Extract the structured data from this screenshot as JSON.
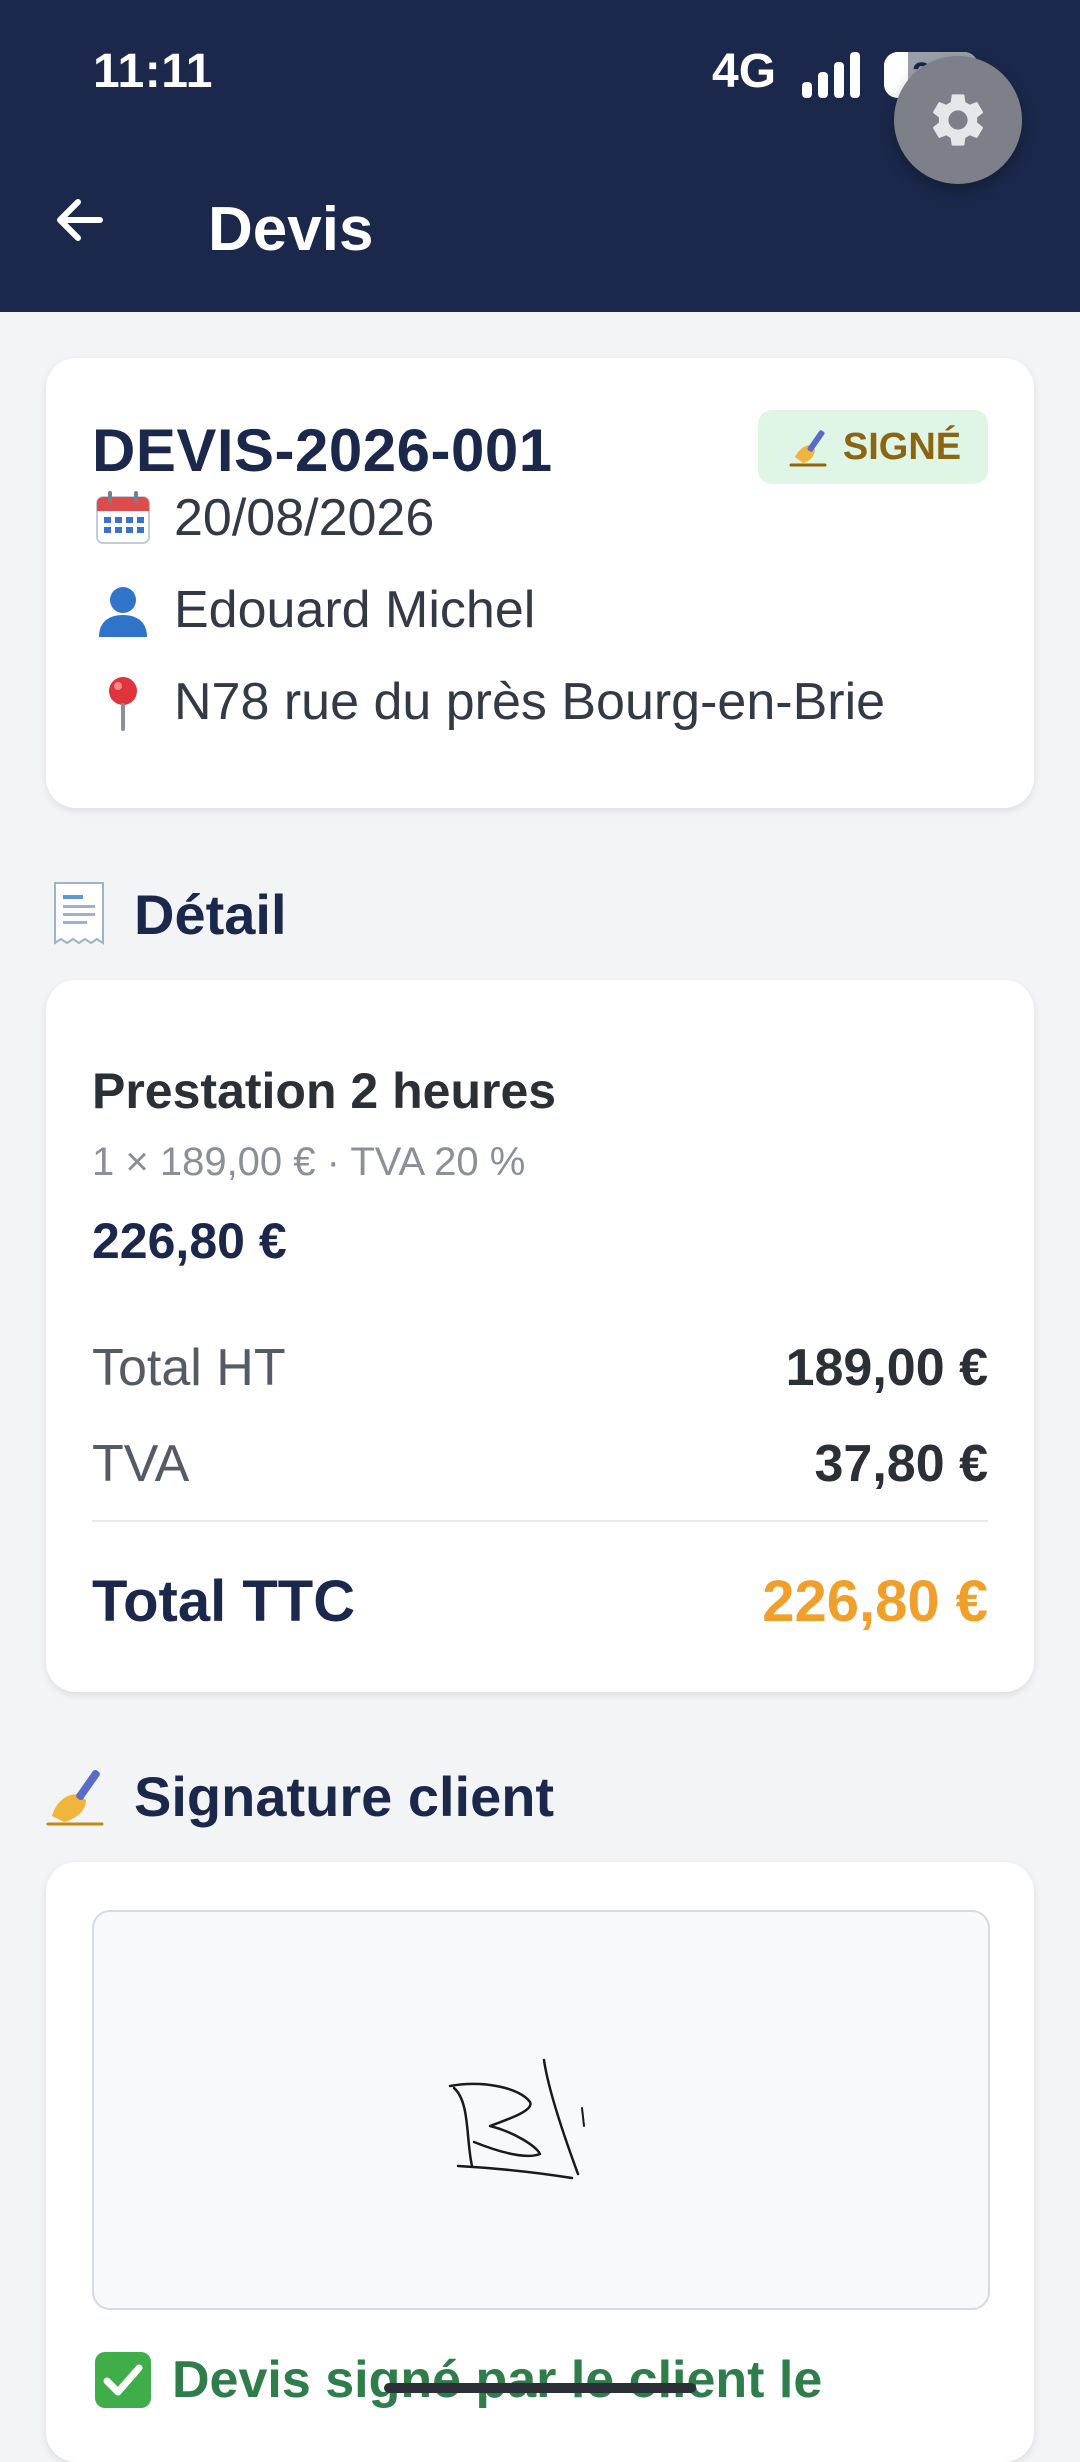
{
  "status_bar": {
    "time": "11:11",
    "network": "4G",
    "battery_level": "25",
    "battery_fraction": 0.25
  },
  "app_bar": {
    "title": "Devis",
    "back_icon": "arrow-left-icon",
    "settings_icon": "gear-icon"
  },
  "quote": {
    "number": "DEVIS-2026-001",
    "status": "SIGNÉ",
    "status_icon": "writing-hand-icon",
    "date": "20/08/2026",
    "client": "Edouard Michel",
    "address": "N78 rue du près Bourg-en-Brie"
  },
  "detail": {
    "title": "Détail",
    "title_icon": "receipt-icon",
    "item": {
      "name": "Prestation 2 heures",
      "meta": "1 × 189,00 € · TVA 20 %",
      "total": "226,80 €"
    },
    "total_ht_label": "Total HT",
    "total_ht_value": "189,00 €",
    "tva_label": "TVA",
    "tva_value": "37,80 €",
    "total_ttc_label": "Total TTC",
    "total_ttc_value": "226,80 €"
  },
  "signature": {
    "title": "Signature client",
    "title_icon": "writing-hand-icon",
    "signed_text": "Devis signé par le client le",
    "signed_icon": "check-mark-button-icon"
  },
  "colors": {
    "header": "#1b284b",
    "accent_orange": "#f0a02a",
    "badge_bg": "#dff5e6",
    "badge_text": "#8b6512",
    "signed_green": "#2e7d4b"
  }
}
